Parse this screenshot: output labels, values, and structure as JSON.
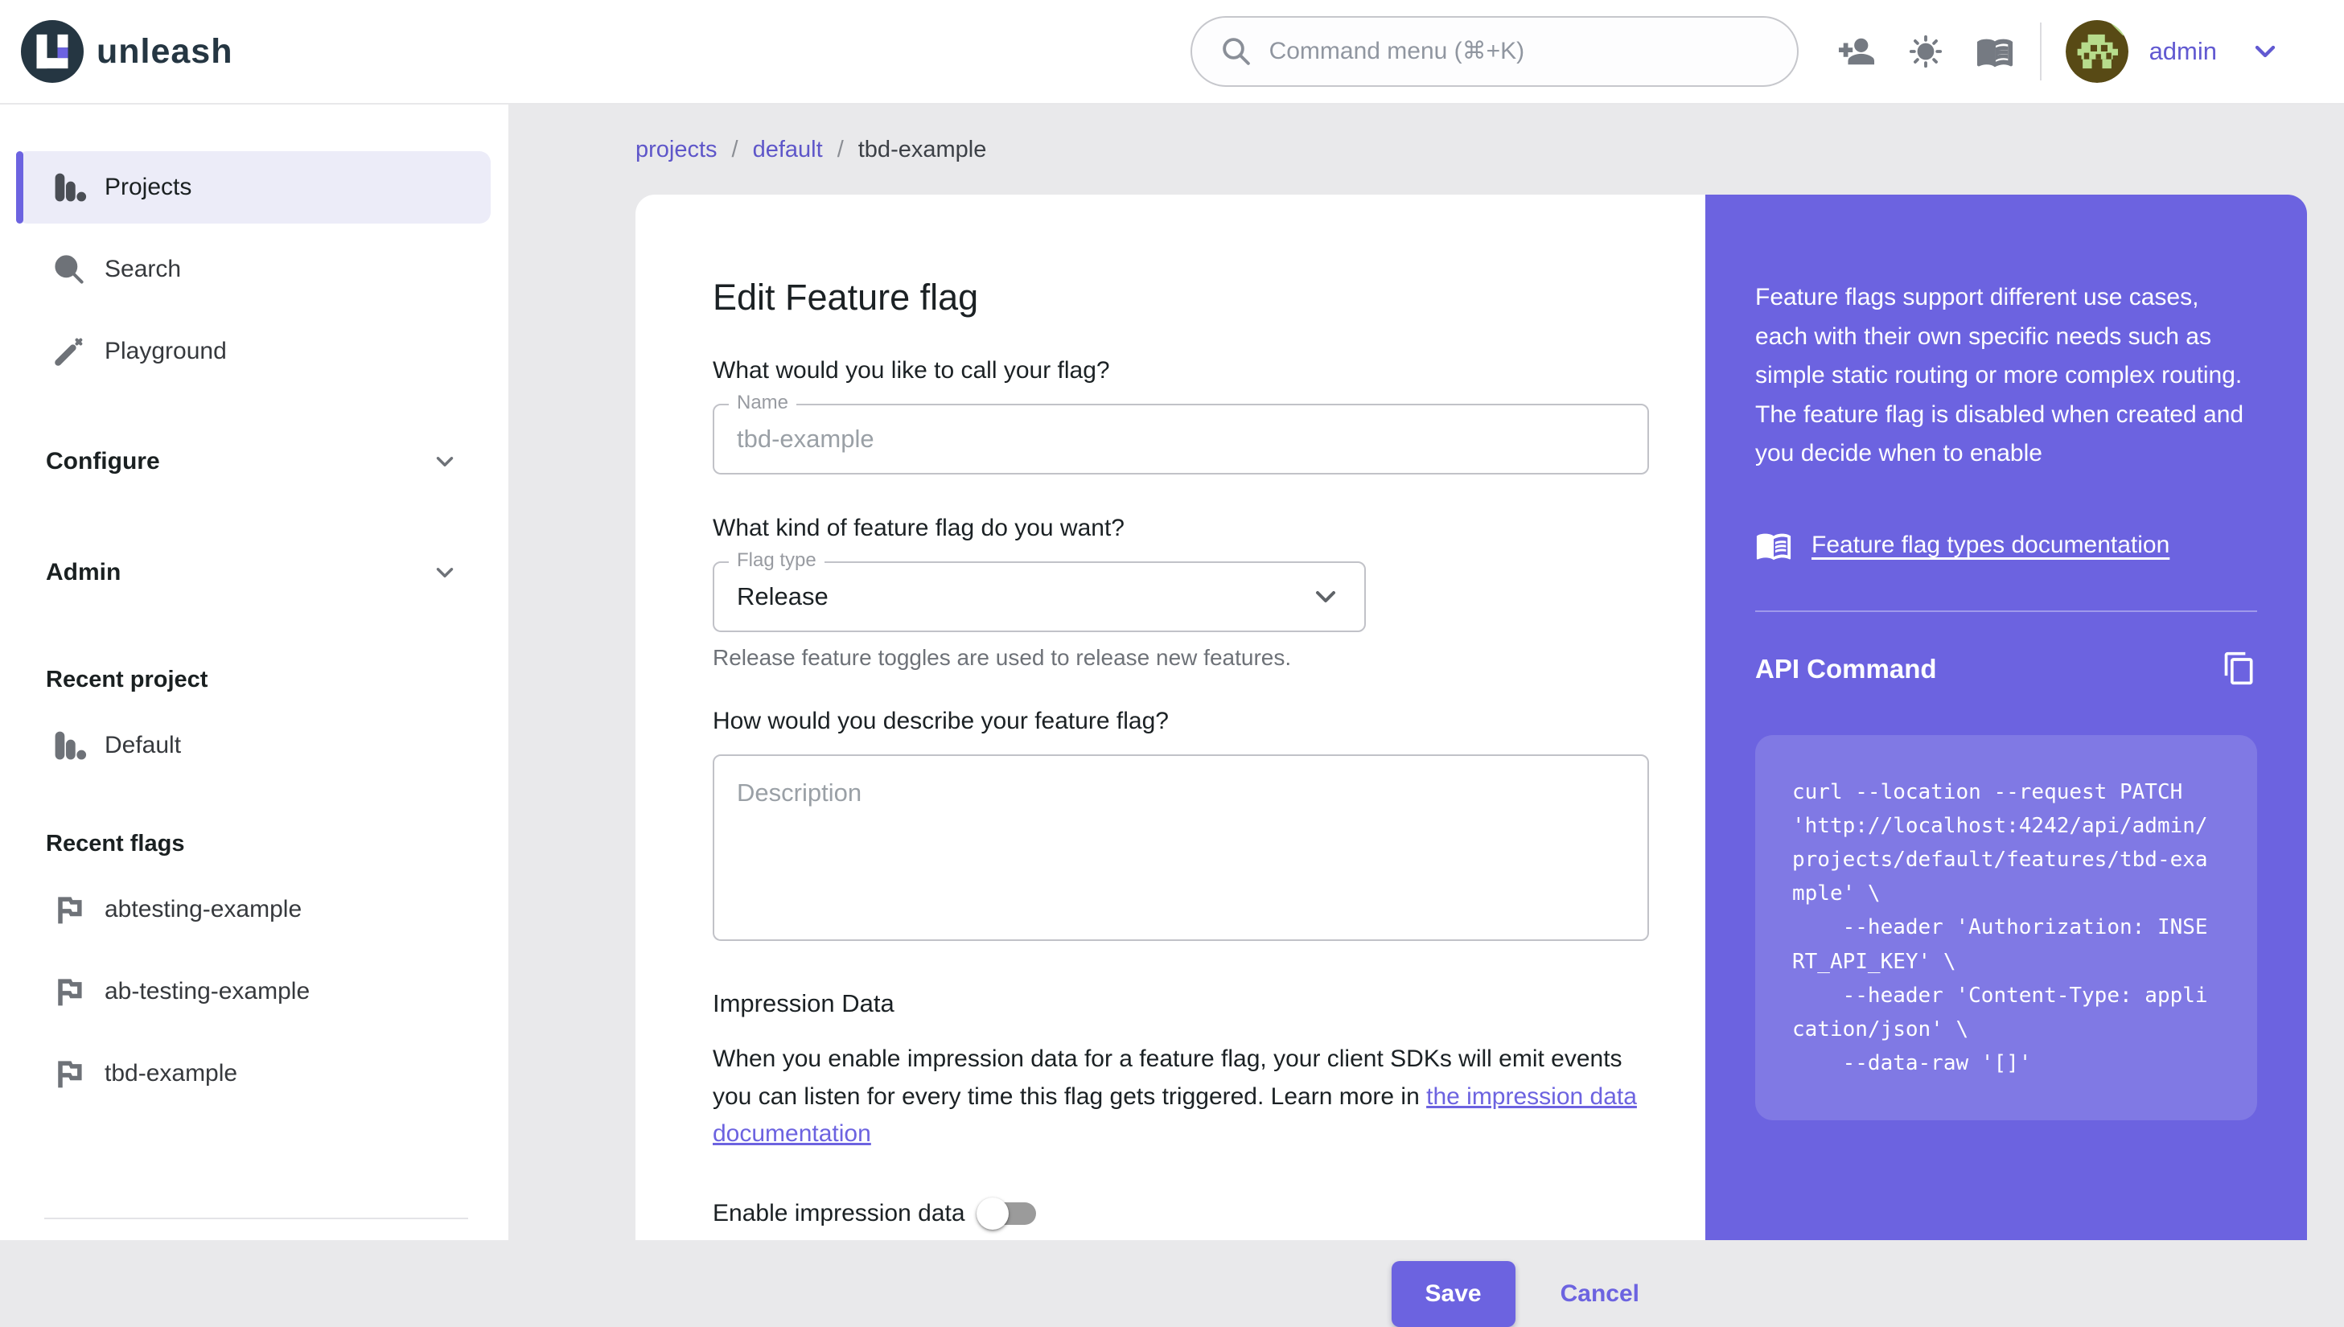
{
  "header": {
    "logo_text": "unleash",
    "command_menu_placeholder": "Command menu (⌘+K)",
    "user": {
      "name": "admin"
    }
  },
  "sidebar": {
    "items": [
      {
        "label": "Projects"
      },
      {
        "label": "Search"
      },
      {
        "label": "Playground"
      }
    ],
    "groups": [
      {
        "label": "Configure"
      },
      {
        "label": "Admin"
      }
    ],
    "recent_project": {
      "title": "Recent project",
      "items": [
        {
          "label": "Default"
        }
      ]
    },
    "recent_flags": {
      "title": "Recent flags",
      "items": [
        {
          "label": "abtesting-example"
        },
        {
          "label": "ab-testing-example"
        },
        {
          "label": "tbd-example"
        }
      ]
    }
  },
  "breadcrumb": {
    "items": [
      "projects",
      "default",
      "tbd-example"
    ]
  },
  "form": {
    "title": "Edit Feature flag",
    "name_question": "What would you like to call your flag?",
    "name_label": "Name",
    "name_value": "tbd-example",
    "type_question": "What kind of feature flag do you want?",
    "type_label": "Flag type",
    "type_value": "Release",
    "type_helper": "Release feature toggles are used to release new features.",
    "desc_question": "How would you describe your feature flag?",
    "desc_placeholder": "Description",
    "impression_title": "Impression Data",
    "impression_text_before": "When you enable impression data for a feature flag, your client SDKs will emit events you can listen for every time this flag gets triggered. Learn more in ",
    "impression_link": "the impression data documentation",
    "toggle_label": "Enable impression data",
    "save_label": "Save",
    "cancel_label": "Cancel"
  },
  "info_panel": {
    "description": "Feature flags support different use cases, each with their own specific needs such as simple static routing or more complex routing. The feature flag is disabled when created and you decide when to enable",
    "doc_link": "Feature flag types documentation",
    "api_title": "API Command",
    "api_code": "curl --location --request PATCH\n'http://localhost:4242/api/admin/\nprojects/default/features/tbd-exa\nmple' \\\n    --header 'Authorization: INSE\nRT_API_KEY' \\\n    --header 'Content-Type: appli\ncation/json' \\\n    --data-raw '[]'"
  },
  "colors": {
    "primary_purple": "#6c63e0",
    "link_purple": "#5e56c9",
    "page_background": "#e9e9eb",
    "active_item_background": "#ececf8",
    "logo_ink": "#253642"
  }
}
